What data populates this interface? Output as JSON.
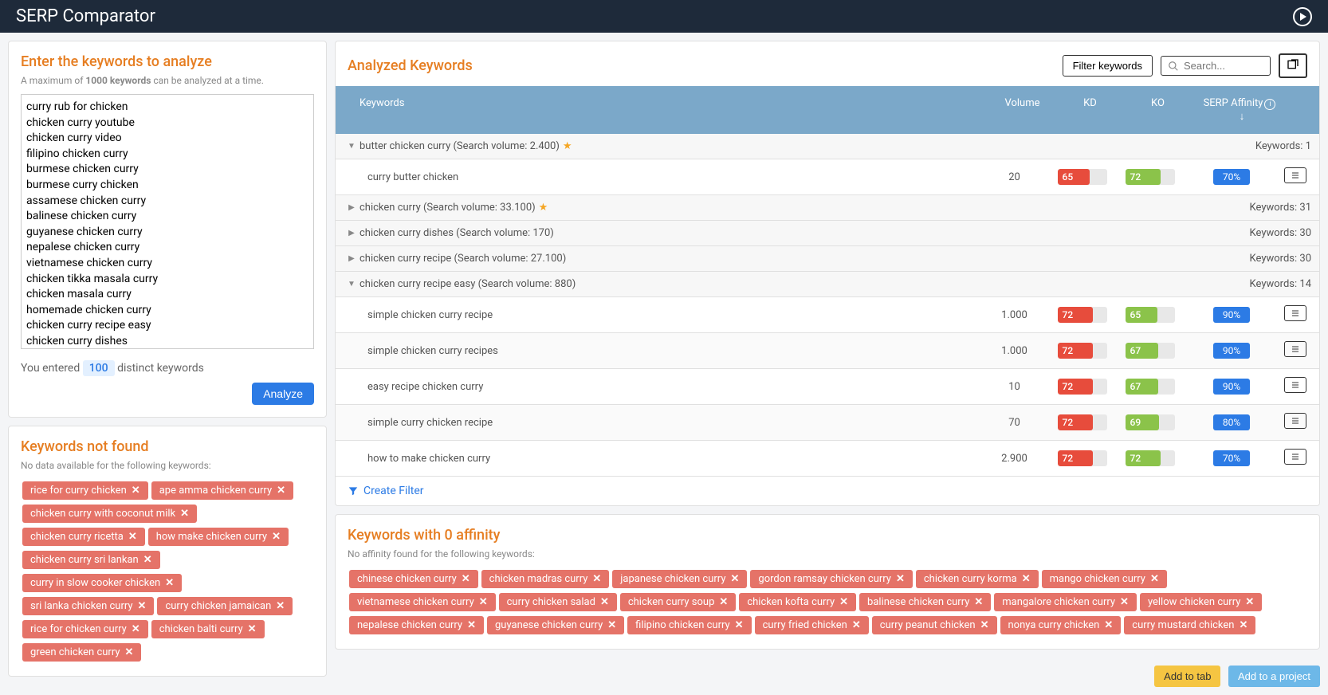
{
  "topbar": {
    "title": "SERP Comparator"
  },
  "enter": {
    "title": "Enter the keywords to analyze",
    "subtitle_pre": "A maximum of ",
    "subtitle_bold": "1000 keywords",
    "subtitle_post": " can be analyzed at a time.",
    "textarea_value": "curry rub for chicken\nchicken curry youtube\nchicken curry video\nfilipino chicken curry\nburmese chicken curry\nburmese curry chicken\nassamese chicken curry\nbalinese chicken curry\nguyanese chicken curry\nnepalese chicken curry\nvietnamese chicken curry\nchicken tikka masala curry\nchicken masala curry\nhomemade chicken curry\nchicken curry recipe easy\nchicken curry dishes",
    "count_pre": "You entered ",
    "count_value": "100",
    "count_post": " distinct keywords",
    "analyze_label": "Analyze"
  },
  "analyzed": {
    "title": "Analyzed Keywords",
    "filter_btn": "Filter keywords",
    "search_placeholder": "Search...",
    "columns": {
      "keywords": "Keywords",
      "volume": "Volume",
      "kd": "KD",
      "ko": "KO",
      "affinity": "SERP Affinity"
    },
    "groups": [
      {
        "expanded": true,
        "label": "butter chicken curry (Search volume: 2.400)",
        "star": true,
        "count": "Keywords: 1",
        "rows": [
          {
            "kw": "curry butter chicken",
            "vol": "20",
            "kd": "65",
            "kd_w": 65,
            "ko": "72",
            "ko_w": 72,
            "aff": "70%"
          }
        ]
      },
      {
        "expanded": false,
        "label": "chicken curry (Search volume: 33.100)",
        "star": true,
        "count": "Keywords: 31",
        "rows": []
      },
      {
        "expanded": false,
        "label": "chicken curry dishes (Search volume: 170)",
        "star": false,
        "count": "Keywords: 30",
        "rows": []
      },
      {
        "expanded": false,
        "label": "chicken curry recipe (Search volume: 27.100)",
        "star": false,
        "count": "Keywords: 30",
        "rows": []
      },
      {
        "expanded": true,
        "label": "chicken curry recipe easy (Search volume: 880)",
        "star": false,
        "count": "Keywords: 14",
        "rows": [
          {
            "kw": "simple chicken curry recipe",
            "vol": "1.000",
            "kd": "72",
            "kd_w": 72,
            "ko": "65",
            "ko_w": 65,
            "aff": "90%"
          },
          {
            "kw": "simple chicken curry recipes",
            "vol": "1.000",
            "kd": "72",
            "kd_w": 72,
            "ko": "67",
            "ko_w": 67,
            "aff": "90%"
          },
          {
            "kw": "easy recipe chicken curry",
            "vol": "10",
            "kd": "72",
            "kd_w": 72,
            "ko": "67",
            "ko_w": 67,
            "aff": "90%"
          },
          {
            "kw": "simple curry chicken recipe",
            "vol": "70",
            "kd": "72",
            "kd_w": 72,
            "ko": "69",
            "ko_w": 69,
            "aff": "80%"
          },
          {
            "kw": "how to make chicken curry",
            "vol": "2.900",
            "kd": "72",
            "kd_w": 72,
            "ko": "72",
            "ko_w": 72,
            "aff": "70%"
          }
        ]
      }
    ],
    "create_filter": "Create Filter"
  },
  "not_found": {
    "title": "Keywords not found",
    "subtitle": "No data available for the following keywords:",
    "tags": [
      "rice for curry chicken",
      "ape amma chicken curry",
      "chicken curry with coconut milk",
      "chicken curry ricetta",
      "how make chicken curry",
      "chicken curry sri lankan",
      "curry in slow cooker chicken",
      "sri lanka chicken curry",
      "curry chicken jamaican",
      "rice for chicken curry",
      "chicken balti curry",
      "green chicken curry"
    ]
  },
  "zero_aff": {
    "title": "Keywords with 0 affinity",
    "subtitle": "No affinity found for the following keywords:",
    "tags": [
      "chinese chicken curry",
      "chicken madras curry",
      "japanese chicken curry",
      "gordon ramsay chicken curry",
      "chicken curry korma",
      "mango chicken curry",
      "vietnamese chicken curry",
      "curry chicken salad",
      "chicken curry soup",
      "chicken kofta curry",
      "balinese chicken curry",
      "mangalore chicken curry",
      "yellow chicken curry",
      "nepalese chicken curry",
      "guyanese chicken curry",
      "filipino chicken curry",
      "curry fried chicken",
      "curry peanut chicken",
      "nonya curry chicken",
      "curry mustard chicken"
    ]
  },
  "footer": {
    "add_tab": "Add to tab",
    "add_project": "Add to a project"
  }
}
